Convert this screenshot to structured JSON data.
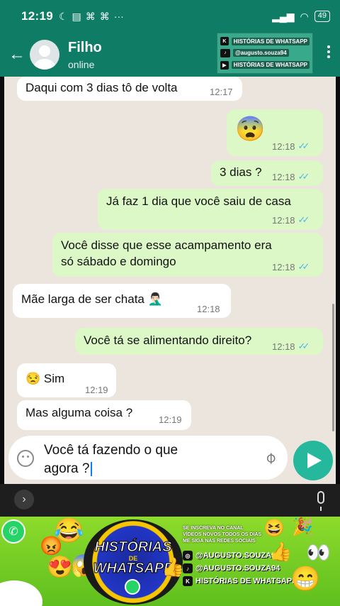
{
  "status_bar": {
    "time": "12:19",
    "left_icons": [
      "moon-icon",
      "sim-icon",
      "app-icon",
      "app-icon",
      "more-icon"
    ],
    "more": "···",
    "battery": "49"
  },
  "header": {
    "contact_name": "Filho",
    "contact_status": "online",
    "channel": {
      "line1": "HISTÓRIAS DE WHATSAPP",
      "line2": "@augusto.souza94",
      "line3": "HISTÓRIAS DE WHATSAPP"
    }
  },
  "messages": [
    {
      "dir": "in",
      "text": "Daqui com 3 dias tô de volta",
      "time": "12:17"
    },
    {
      "dir": "out",
      "text": "😨",
      "time": "12:18",
      "ticks": "✓✓"
    },
    {
      "dir": "out",
      "text": "3 dias ?",
      "time": "12:18",
      "ticks": "✓✓"
    },
    {
      "dir": "out",
      "text": "Já faz 1 dia que você saiu de casa",
      "time": "12:18",
      "ticks": "✓✓"
    },
    {
      "dir": "out",
      "line1": "Você disse que esse acampamento era",
      "line2": "só sábado e domingo",
      "time": "12:18",
      "ticks": "✓✓"
    },
    {
      "dir": "in",
      "text": "Mãe larga de ser chata 🤦🏻‍♂️",
      "time": "12:18"
    },
    {
      "dir": "out",
      "text": "Você tá se alimentando direito?",
      "time": "12:18",
      "ticks": "✓✓"
    },
    {
      "dir": "in",
      "text": "😒 Sim",
      "time": "12:19"
    },
    {
      "dir": "in",
      "text": "Mas alguma coisa ?",
      "time": "12:19"
    }
  ],
  "composer": {
    "line1": "Você tá fazendo o que",
    "line2": "agora ?"
  },
  "banner": {
    "logo_top": "HISTÓRIAS",
    "logo_mid": "DE",
    "logo_bottom": "WHATSAPP",
    "promo_lines": [
      "SE INSCREVA NO CANAL",
      "VÍDEOS NOVOS TODOS OS DIAS",
      "ME SIGA NAS REDES SOCIAIS"
    ],
    "instagram": "@AUGUSTO.SOUZA94",
    "tiktok": "@AUGUSTO.SOUZA94",
    "kwai": "HISTÓRIAS DE WHATSAPP"
  },
  "colors": {
    "header": "#0f7c66",
    "chat_bg": "#ece5dd",
    "bubble_in": "#ffffff",
    "bubble_out": "#dcf8c6",
    "send": "#25b89d",
    "read_ticks": "#4fb6ec"
  }
}
